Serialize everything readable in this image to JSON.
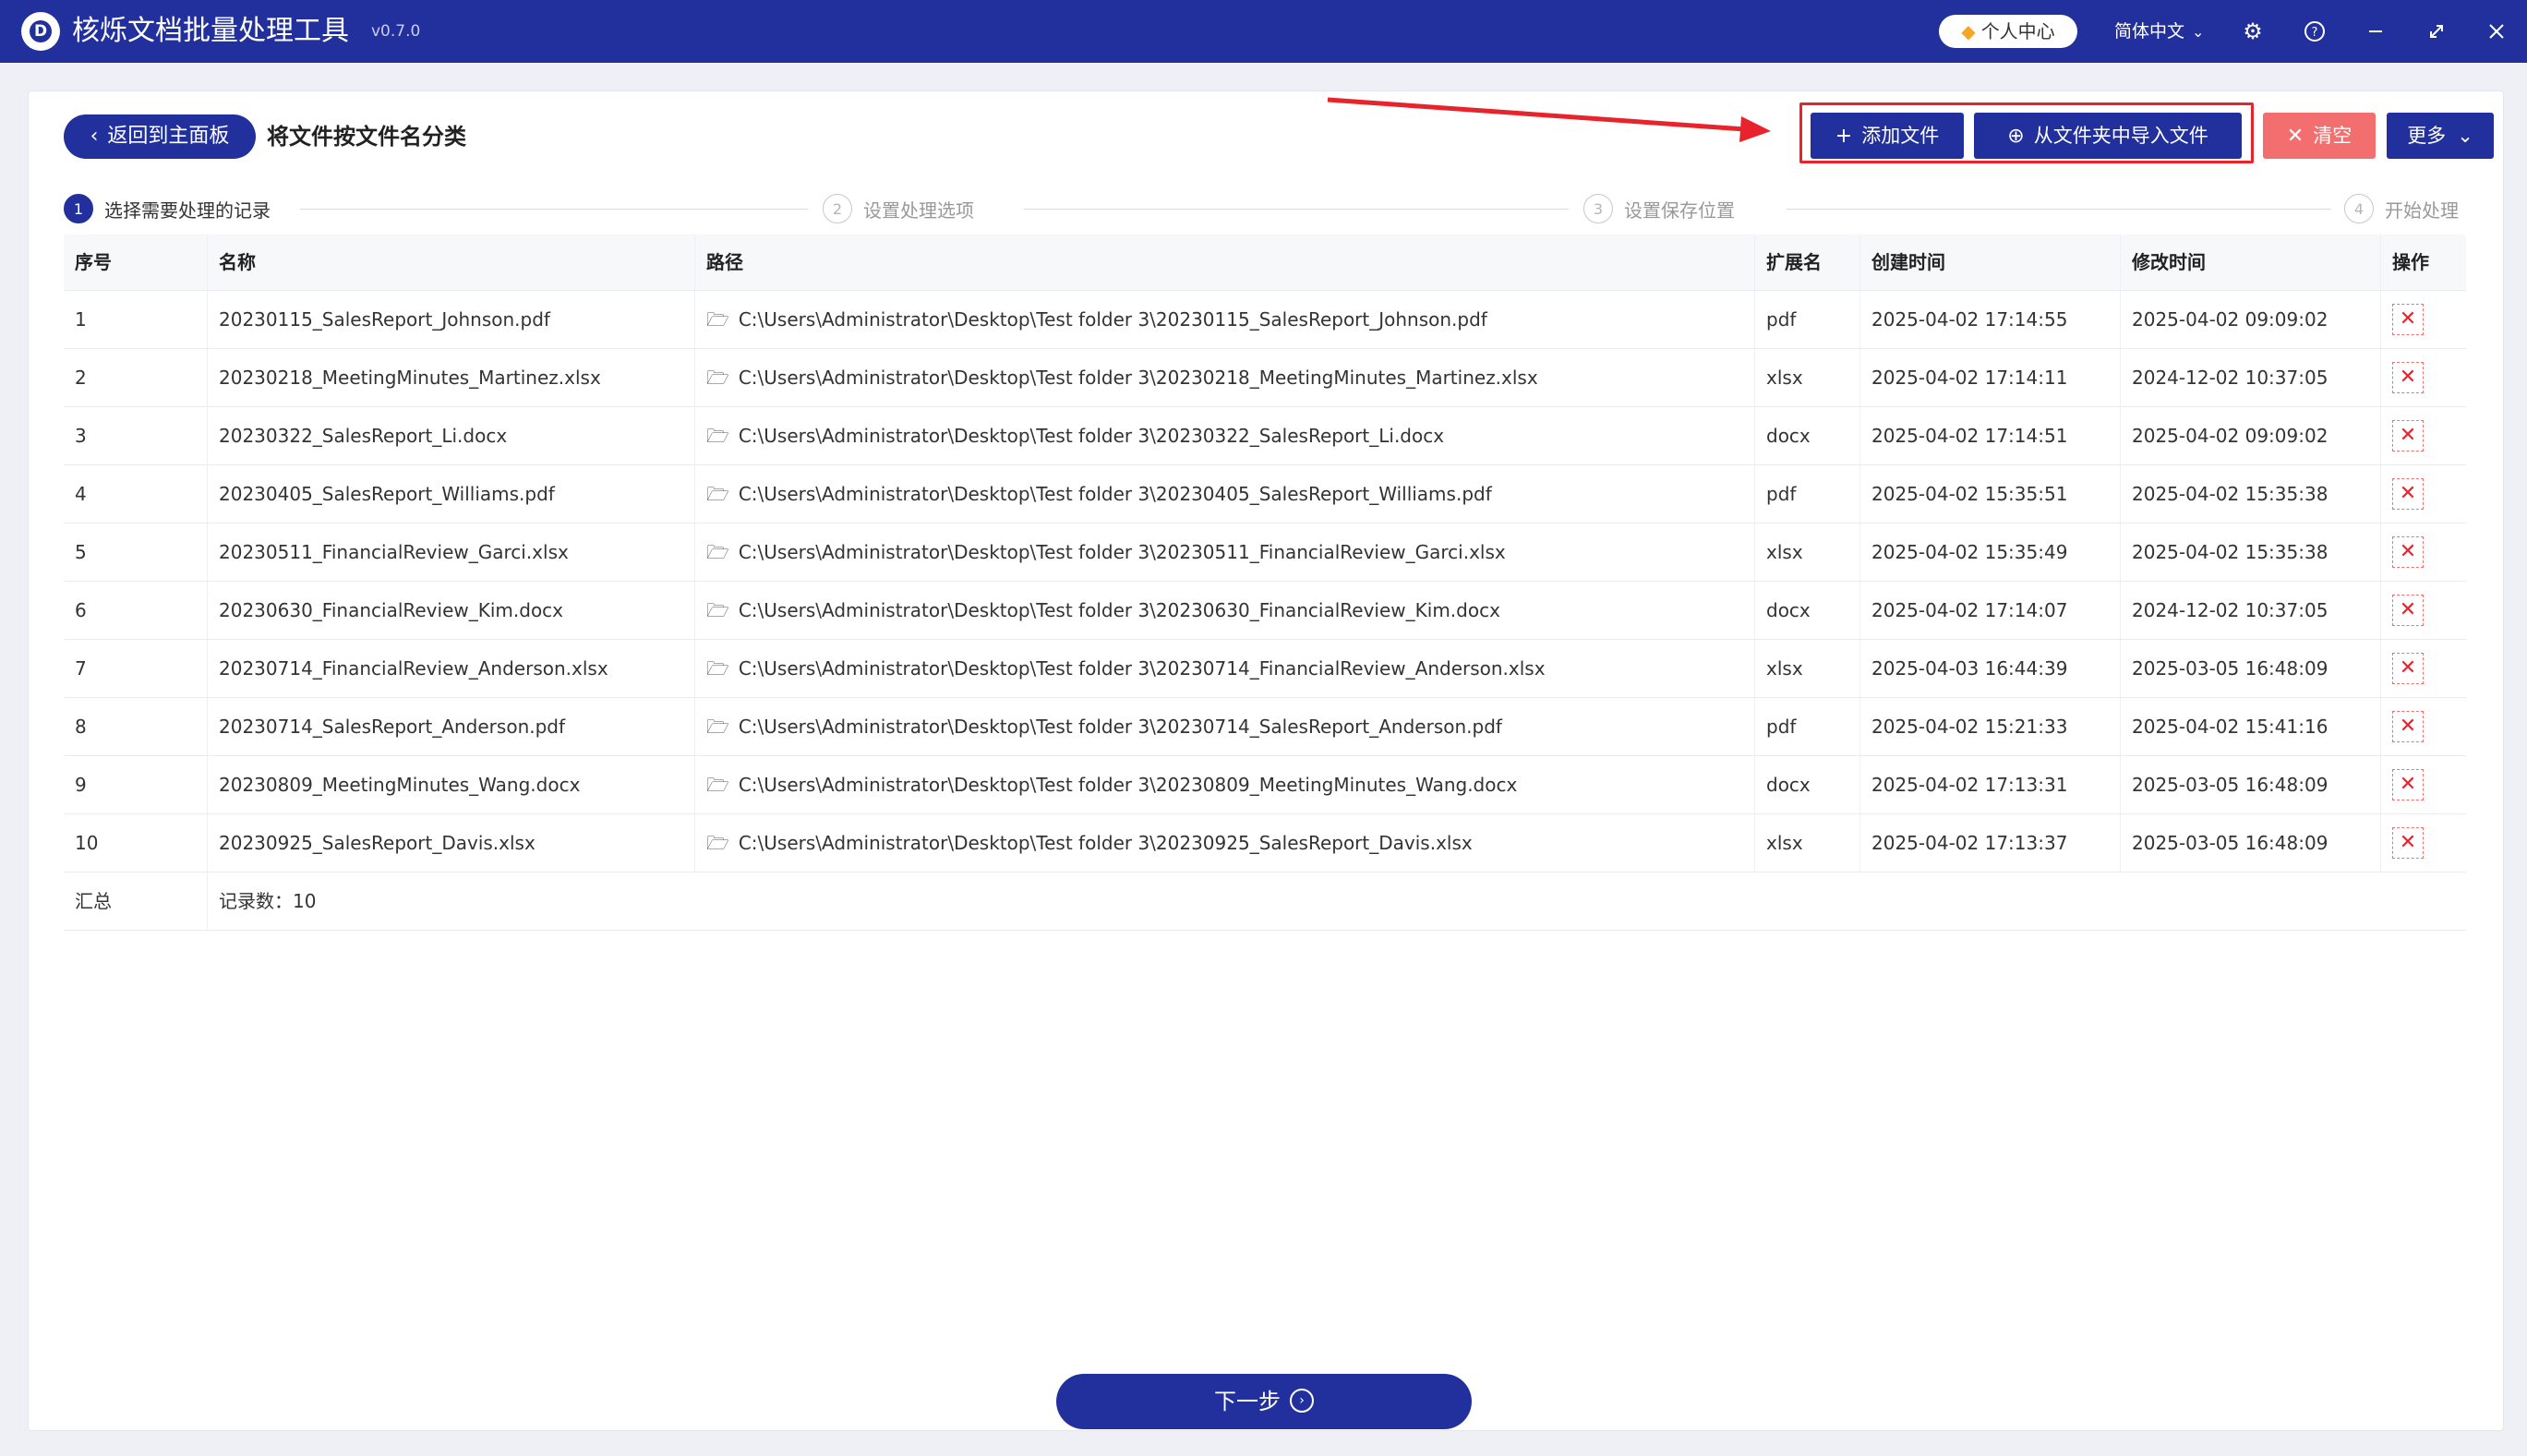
{
  "app": {
    "title": "核烁文档批量处理工具",
    "version": "v0.7.0",
    "logo_letter": "D",
    "user_center": "个人中心",
    "language": "简体中文",
    "icons": [
      "diamond-icon",
      "chevron-down-icon",
      "gear-icon",
      "help-icon",
      "minimize-icon",
      "maximize-icon",
      "close-icon"
    ]
  },
  "toolbar": {
    "back_label": "返回到主面板",
    "page_title": "将文件按文件名分类",
    "add_file": "添加文件",
    "import_folder": "从文件夹中导入文件",
    "clear": "清空",
    "more": "更多"
  },
  "steps": [
    {
      "num": "1",
      "label": "选择需要处理的记录",
      "active": true
    },
    {
      "num": "2",
      "label": "设置处理选项",
      "active": false
    },
    {
      "num": "3",
      "label": "设置保存位置",
      "active": false
    },
    {
      "num": "4",
      "label": "开始处理",
      "active": false
    }
  ],
  "table": {
    "headers": [
      "序号",
      "名称",
      "路径",
      "扩展名",
      "创建时间",
      "修改时间",
      "操作"
    ],
    "rows": [
      {
        "no": "1",
        "name": "20230115_SalesReport_Johnson.pdf",
        "path": "C:\\Users\\Administrator\\Desktop\\Test folder 3\\20230115_SalesReport_Johnson.pdf",
        "ext": "pdf",
        "created": "2025-04-02 17:14:55",
        "modified": "2025-04-02 09:09:02"
      },
      {
        "no": "2",
        "name": "20230218_MeetingMinutes_Martinez.xlsx",
        "path": "C:\\Users\\Administrator\\Desktop\\Test folder 3\\20230218_MeetingMinutes_Martinez.xlsx",
        "ext": "xlsx",
        "created": "2025-04-02 17:14:11",
        "modified": "2024-12-02 10:37:05"
      },
      {
        "no": "3",
        "name": "20230322_SalesReport_Li.docx",
        "path": "C:\\Users\\Administrator\\Desktop\\Test folder 3\\20230322_SalesReport_Li.docx",
        "ext": "docx",
        "created": "2025-04-02 17:14:51",
        "modified": "2025-04-02 09:09:02"
      },
      {
        "no": "4",
        "name": "20230405_SalesReport_Williams.pdf",
        "path": "C:\\Users\\Administrator\\Desktop\\Test folder 3\\20230405_SalesReport_Williams.pdf",
        "ext": "pdf",
        "created": "2025-04-02 15:35:51",
        "modified": "2025-04-02 15:35:38"
      },
      {
        "no": "5",
        "name": "20230511_FinancialReview_Garci.xlsx",
        "path": "C:\\Users\\Administrator\\Desktop\\Test folder 3\\20230511_FinancialReview_Garci.xlsx",
        "ext": "xlsx",
        "created": "2025-04-02 15:35:49",
        "modified": "2025-04-02 15:35:38"
      },
      {
        "no": "6",
        "name": "20230630_FinancialReview_Kim.docx",
        "path": "C:\\Users\\Administrator\\Desktop\\Test folder 3\\20230630_FinancialReview_Kim.docx",
        "ext": "docx",
        "created": "2025-04-02 17:14:07",
        "modified": "2024-12-02 10:37:05"
      },
      {
        "no": "7",
        "name": "20230714_FinancialReview_Anderson.xlsx",
        "path": "C:\\Users\\Administrator\\Desktop\\Test folder 3\\20230714_FinancialReview_Anderson.xlsx",
        "ext": "xlsx",
        "created": "2025-04-03 16:44:39",
        "modified": "2025-03-05 16:48:09"
      },
      {
        "no": "8",
        "name": "20230714_SalesReport_Anderson.pdf",
        "path": "C:\\Users\\Administrator\\Desktop\\Test folder 3\\20230714_SalesReport_Anderson.pdf",
        "ext": "pdf",
        "created": "2025-04-02 15:21:33",
        "modified": "2025-04-02 15:41:16"
      },
      {
        "no": "9",
        "name": "20230809_MeetingMinutes_Wang.docx",
        "path": "C:\\Users\\Administrator\\Desktop\\Test folder 3\\20230809_MeetingMinutes_Wang.docx",
        "ext": "docx",
        "created": "2025-04-02 17:13:31",
        "modified": "2025-03-05 16:48:09"
      },
      {
        "no": "10",
        "name": "20230925_SalesReport_Davis.xlsx",
        "path": "C:\\Users\\Administrator\\Desktop\\Test folder 3\\20230925_SalesReport_Davis.xlsx",
        "ext": "xlsx",
        "created": "2025-04-02 17:13:37",
        "modified": "2025-03-05 16:48:09"
      }
    ],
    "summary_label": "汇总",
    "summary_value": "记录数：10"
  },
  "footer": {
    "next_label": "下一步"
  },
  "colors": {
    "primary": "#21309c",
    "danger": "#f36f6f",
    "annotation_red": "#e8232b"
  }
}
